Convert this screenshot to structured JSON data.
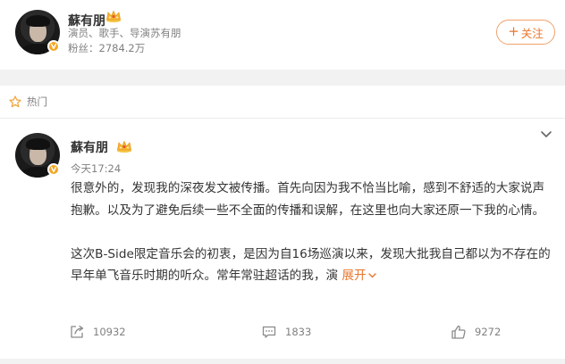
{
  "profile": {
    "name": "蘇有朋",
    "description": "演员、歌手、导演苏有朋",
    "fans": "粉丝：2784.2万",
    "follow_label": "关注"
  },
  "post": {
    "hot_label": "热门",
    "author": "蘇有朋",
    "time": "今天17:24",
    "paragraph1": "很意外的，发现我的深夜发文被传播。首先向因为我不恰当比喻，感到不舒适的大家说声抱歉。以及为了避免后续一些不全面的传播和误解，在这里也向大家还原一下我的心情。",
    "paragraph2": "这次B-Side限定音乐会的初衷，是因为自16场巡演以来，发现大批我自己都以为不存在的早年单飞音乐时期的听众。常年常驻超话的我，演",
    "expand_label": "展开",
    "shares": "10932",
    "comments": "1833",
    "likes": "9272"
  },
  "icons": {
    "verified": "verified-badge-icon",
    "crown": "vip-crown-icon",
    "hot": "star-hot-icon",
    "more": "chevron-down-icon",
    "share": "share-icon",
    "comment": "comment-icon",
    "like": "thumb-up-icon"
  },
  "colors": {
    "accent": "#e8762b",
    "badge": "#f5a623",
    "muted_text": "#808080"
  }
}
